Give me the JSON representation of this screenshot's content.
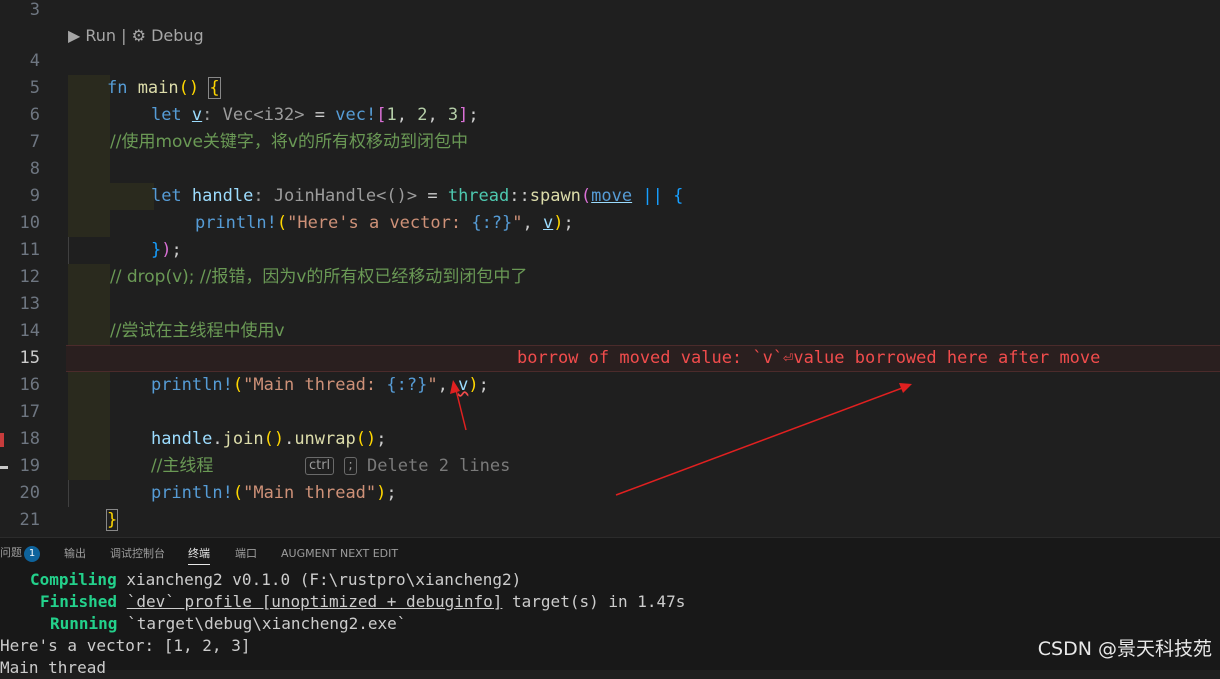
{
  "editor": {
    "codelens": {
      "run": "▶ Run",
      "separator": " | ",
      "debug": "⚙ Debug"
    },
    "line_numbers": [
      "3",
      "4",
      "5",
      "6",
      "7",
      "8",
      "9",
      "10",
      "11",
      "12",
      "13",
      "14",
      "15",
      "16",
      "17",
      "18",
      "19",
      "20",
      "21"
    ],
    "active_line": "15",
    "code": {
      "l4": {
        "kw": "fn",
        "name": "main",
        "parens": "()",
        "brace": "{"
      },
      "l5": {
        "kw": "let",
        "var": "v",
        "hint": ": Vec<i32>",
        "eq": " = ",
        "macro": "vec!",
        "ob": "[",
        "n1": "1",
        "c1": ", ",
        "n2": "2",
        "c2": ", ",
        "n3": "3",
        "cb": "]",
        "semi": ";"
      },
      "l7": {
        "comment": "//使用move关键字，将v的所有权移动到闭包中"
      },
      "l8": {
        "kw": "let",
        "var": "handle",
        "hint": ": JoinHandle<()>",
        "eq": " = ",
        "module": "thread",
        "sep": "::",
        "fn": "spawn",
        "op": "(",
        "kw2": "move",
        "pipes": " || ",
        "brace": "{"
      },
      "l9": {
        "macro": "println!",
        "op": "(",
        "str1": "\"Here's a vector: ",
        "fmt": "{:?}",
        "str2": "\"",
        "comma": ", ",
        "var": "v",
        "cp": ")",
        "semi": ";"
      },
      "l10": {
        "brace": "}",
        "paren": ")",
        "semi": ";"
      },
      "l12": {
        "comment": "// drop(v); //报错，因为v的所有权已经移动到闭包中了"
      },
      "l14": {
        "comment": "//尝试在主线程中使用v"
      },
      "l15": {
        "macro": "println!",
        "op": "(",
        "str1": "\"Main thread: ",
        "fmt": "{:?}",
        "str2": "\"",
        "comma": ", ",
        "var": "v",
        "cp": ")",
        "semi": ";",
        "error": "borrow of moved value: `v`⏎value borrowed here after move"
      },
      "l17": {
        "var": "handle",
        "dot1": ".",
        "fn1": "join",
        "p1": "()",
        "dot2": ".",
        "fn2": "unwrap",
        "p2": "()",
        "semi": ";"
      },
      "l18": {
        "comment": "//主线程",
        "kbd1": "ctrl",
        "kbd2": ";",
        "ghost": "Delete 2 lines"
      },
      "l19": {
        "macro": "println!",
        "op": "(",
        "str": "\"Main thread\"",
        "cp": ")",
        "semi": ";"
      },
      "l20": {
        "brace": "}"
      }
    },
    "colors": {
      "error": "#f14c4c",
      "arrow": "#e02020"
    }
  },
  "panel": {
    "tabs": [
      {
        "label": "问题",
        "badge": "1"
      },
      {
        "label": "输出"
      },
      {
        "label": "调试控制台"
      },
      {
        "label": "终端",
        "active": true
      },
      {
        "label": "端口"
      },
      {
        "label": "AUGMENT NEXT EDIT"
      }
    ],
    "terminal": [
      {
        "status": "Compiling",
        "text": " xiancheng2 v0.1.0 (F:\\rustpro\\xiancheng2)"
      },
      {
        "status": "Finished",
        "sp": " ",
        "dev": "`dev` profile [unoptimized + debuginfo]",
        "rest": " target(s) in 1.47s"
      },
      {
        "status": "Running",
        "text": " `target\\debug\\xiancheng2.exe`"
      },
      {
        "text": "Here's a vector: [1, 2, 3]"
      },
      {
        "text": "Main thread"
      }
    ]
  },
  "watermark": "CSDN @景天科技苑"
}
